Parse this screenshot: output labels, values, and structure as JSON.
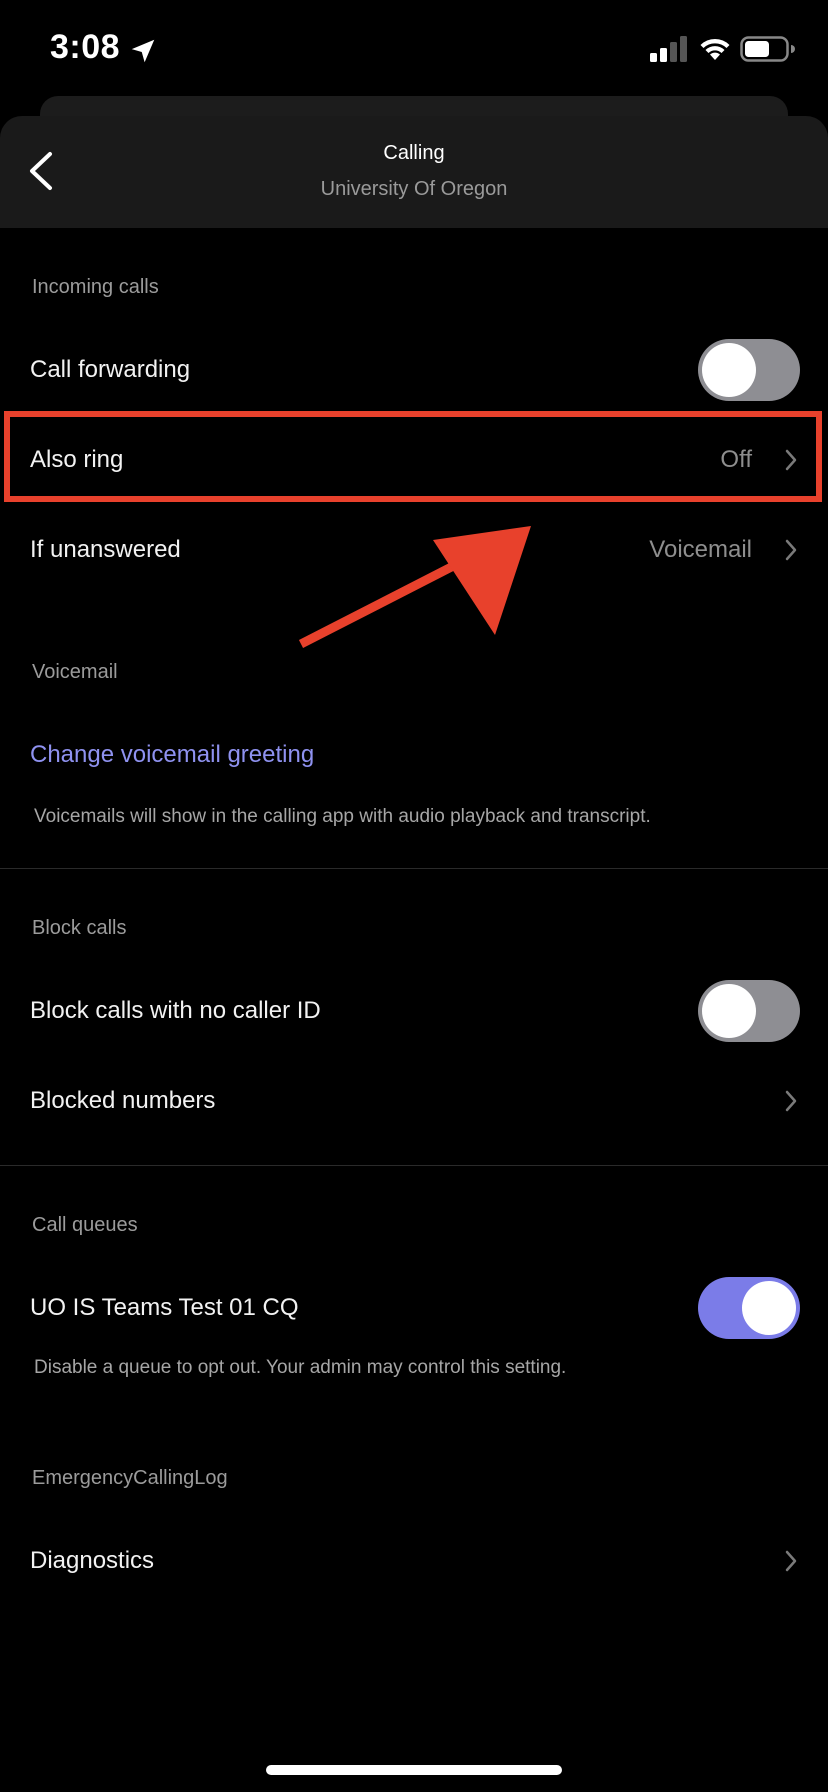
{
  "status_bar": {
    "time": "3:08"
  },
  "header": {
    "title": "Calling",
    "subtitle": "University Of Oregon"
  },
  "incoming_calls": {
    "section_title": "Incoming calls",
    "call_forwarding": {
      "label": "Call forwarding",
      "enabled": false
    },
    "also_ring": {
      "label": "Also ring",
      "value": "Off"
    },
    "if_unanswered": {
      "label": "If unanswered",
      "value": "Voicemail"
    }
  },
  "voicemail": {
    "section_title": "Voicemail",
    "change_greeting_label": "Change voicemail greeting",
    "footnote": "Voicemails will show in the calling app with audio playback and transcript."
  },
  "block_calls": {
    "section_title": "Block calls",
    "no_caller_id": {
      "label": "Block calls with no caller ID",
      "enabled": false
    },
    "blocked_numbers_label": "Blocked numbers"
  },
  "call_queues": {
    "section_title": "Call queues",
    "queue": {
      "label": "UO IS Teams Test 01 CQ",
      "enabled": true
    },
    "footnote": "Disable a queue to opt out. Your admin may control this setting."
  },
  "emergency": {
    "section_title": "EmergencyCallingLog",
    "diagnostics_label": "Diagnostics"
  },
  "colors": {
    "accent": "#7b7ce8",
    "annotation": "#e8412c",
    "toggle_off": "#8e8e93"
  }
}
